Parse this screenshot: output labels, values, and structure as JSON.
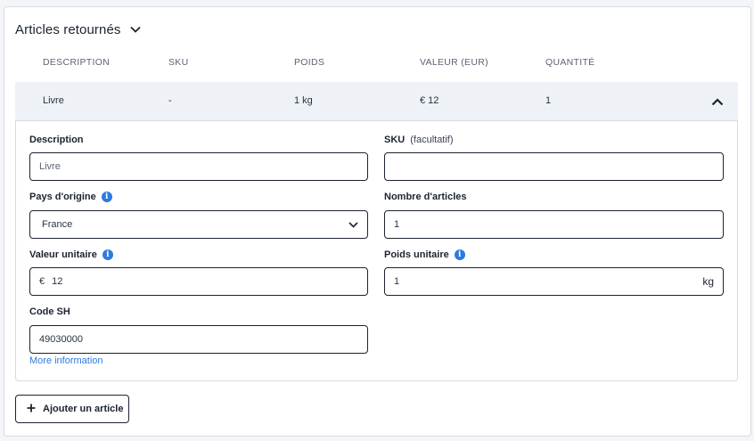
{
  "section": {
    "title": "Articles retournés"
  },
  "table": {
    "headers": [
      "DESCRIPTION",
      "SKU",
      "POIDS",
      "VALEUR (EUR)",
      "QUANTITÉ"
    ],
    "row": {
      "description": "Livre",
      "sku": "-",
      "poids": "1 kg",
      "valeur": "€ 12",
      "quantite": "1"
    }
  },
  "form": {
    "description": {
      "label": "Description",
      "value": "Livre"
    },
    "sku": {
      "label": "SKU",
      "optional": "(facultatif)",
      "value": ""
    },
    "pays": {
      "label": "Pays d'origine",
      "value": "France"
    },
    "nombre": {
      "label": "Nombre d'articles",
      "value": "1"
    },
    "valeur": {
      "label": "Valeur unitaire",
      "prefix": "€",
      "value": "12"
    },
    "poids": {
      "label": "Poids unitaire",
      "value": "1",
      "unit": "kg"
    },
    "code_sh": {
      "label": "Code SH",
      "value": "49030000"
    },
    "more_info": "More information"
  },
  "actions": {
    "add_label": "Ajouter un article"
  },
  "icons": {
    "info": "info-icon",
    "chevron_down": "chevron-down-icon",
    "chevron_up": "chevron-up-icon",
    "plus": "plus-icon"
  },
  "colors": {
    "accent": "#2b7be0",
    "border": "#1c2330",
    "row_bg": "#eef1f6"
  }
}
